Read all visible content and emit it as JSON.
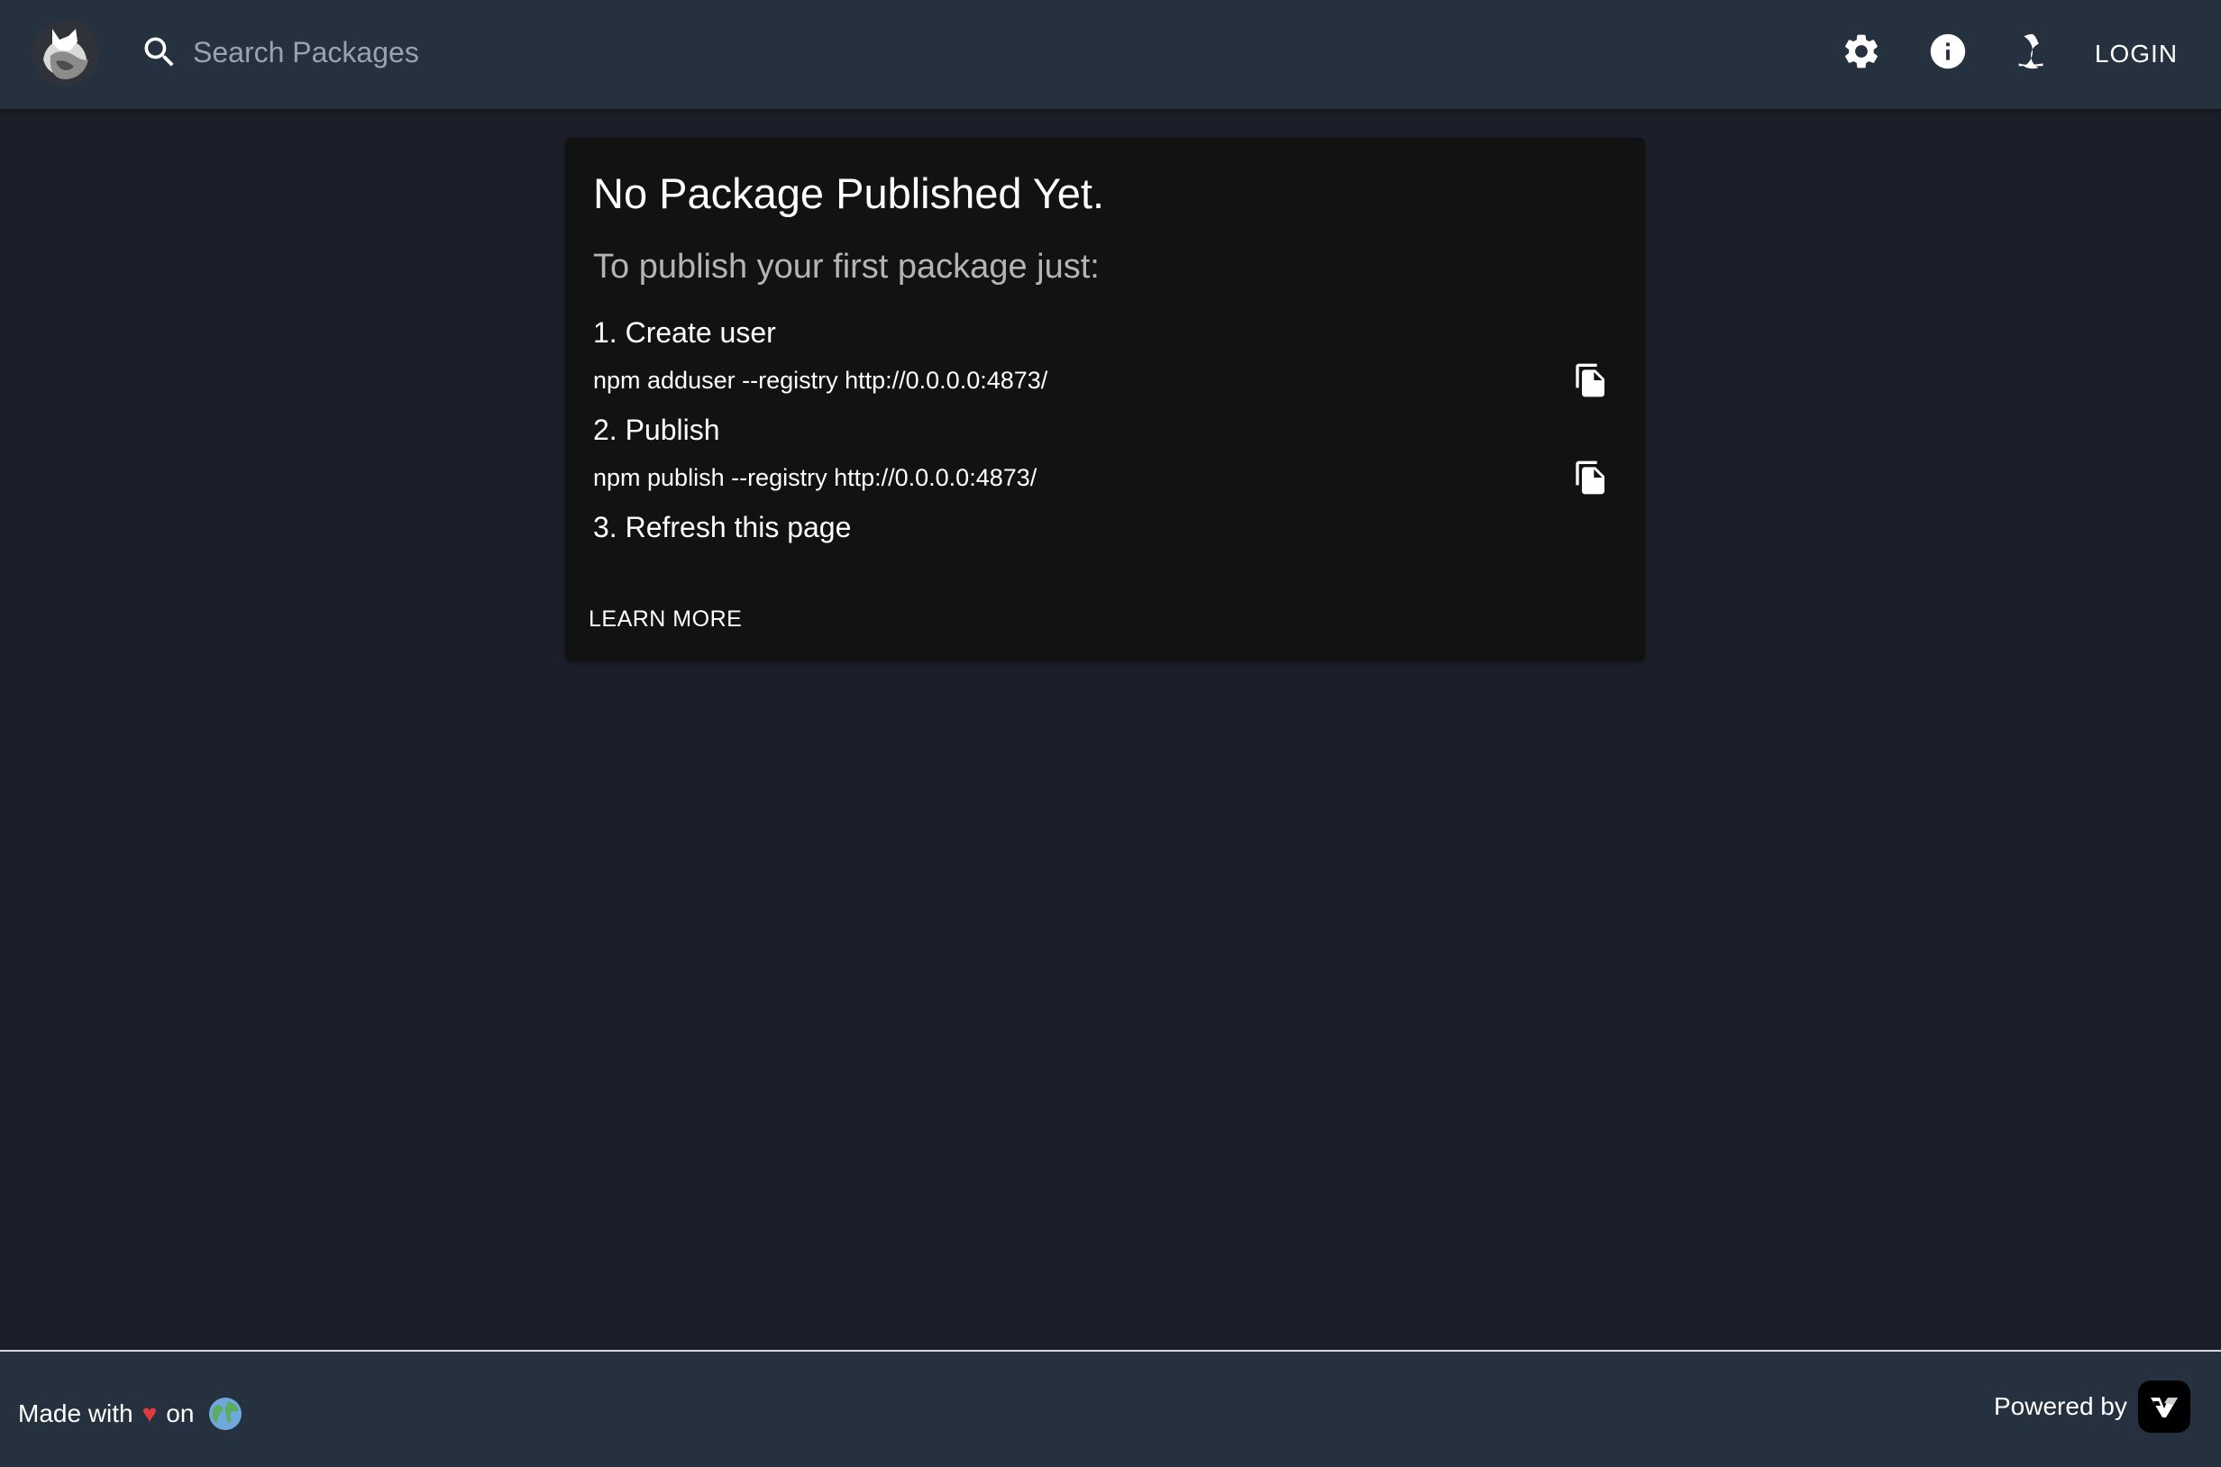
{
  "header": {
    "logo_icon": "verdaccio-fox-logo",
    "search": {
      "placeholder": "Search Packages",
      "value": "",
      "icon": "search-icon"
    },
    "settings_icon": "gear-icon",
    "info_icon": "info-icon",
    "theme_icon": "moon-icon",
    "login_label": "LOGIN",
    "background_color": "#263140"
  },
  "card": {
    "title": "No Package Published Yet.",
    "subtitle": "To publish your first package just:",
    "steps": [
      {
        "label": "1. Create user",
        "command": "npm adduser --registry http://0.0.0.0:4873/",
        "copy_icon": "copy-icon"
      },
      {
        "label": "2. Publish",
        "command": "npm publish --registry http://0.0.0.0:4873/",
        "copy_icon": "copy-icon"
      },
      {
        "label": "3. Refresh this page"
      }
    ],
    "learn_more_label": "LEARN MORE",
    "background_color": "#121212"
  },
  "footer": {
    "made_with": "Made with",
    "heart": "♥",
    "on": "on",
    "globe_icon": "globe-icon",
    "powered_by": "Powered by",
    "powered_logo": "verdaccio-logo",
    "heart_color": "#e0393e"
  },
  "page": {
    "background_color": "#1c1f29"
  }
}
